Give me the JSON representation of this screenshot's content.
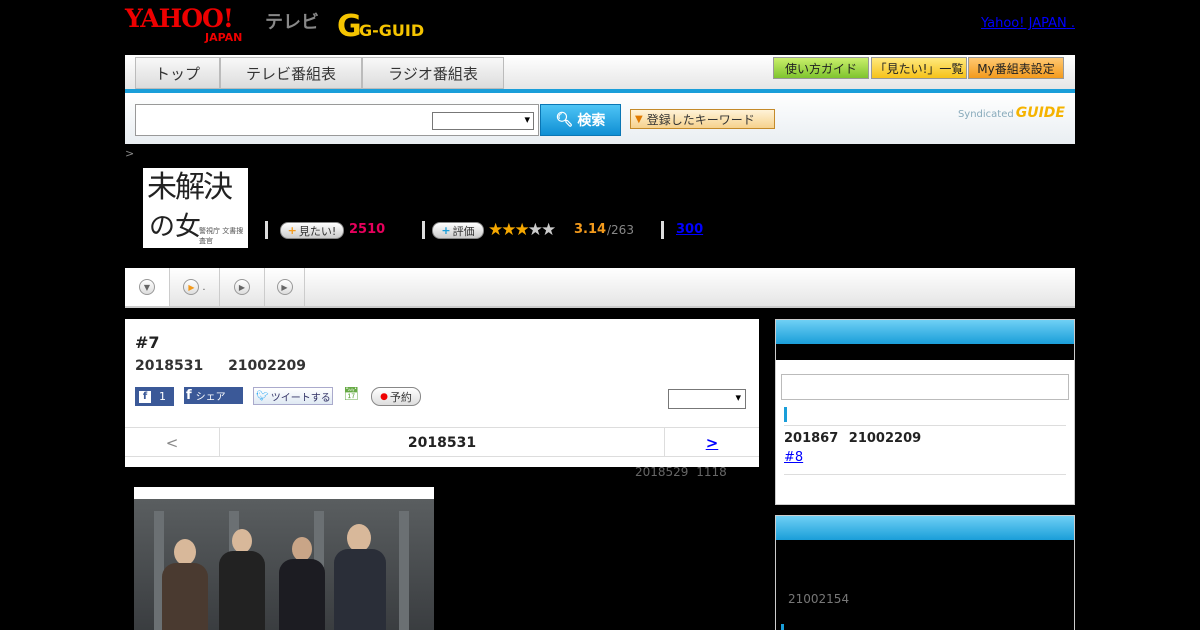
{
  "header": {
    "yahoo_logo": "YAHOO!",
    "japan_logo": "JAPAN",
    "tv_logo": "テレビ",
    "gguide_logo": "G-GUIDE",
    "yahoo_japan_link": "Yahoo! JAPAN"
  },
  "nav": {
    "tabs": [
      {
        "label": "トップ"
      },
      {
        "label": "テレビ番組表"
      },
      {
        "label": "ラジオ番組表"
      }
    ],
    "guide_label": "使い方ガイド",
    "mitai_list_label": "「見たい!」一覧",
    "my_schedule_label": "My番組表設定"
  },
  "search": {
    "input_value": "",
    "select_value": "",
    "button_label": "検索",
    "keyword_label": "登録したキーワード",
    "syndicated_label": "Syndicated",
    "syndicated_logo": "GUIDE"
  },
  "breadcrumb": ">",
  "program": {
    "title_line1": "未解決",
    "title_line2": "の女",
    "title_sub": "警視庁 文書捜査官",
    "mitai_label": "見たい!",
    "mitai_count": "2510",
    "eval_label": "評価",
    "rating": 3.14,
    "stars": "★★★★★",
    "score": "3.14",
    "votes": "/263",
    "comments": "300"
  },
  "episode": {
    "title": "#7",
    "date_time": "2018531 21002209",
    "fb_count": "1",
    "fb_share_label": "シェア",
    "tweet_label": "ツイートする",
    "reserve_label": "予約",
    "select_value": "",
    "nav_prev": "<",
    "nav_current": "2018531",
    "nav_next": ">",
    "updated": "2018529 1118"
  },
  "sidebar": {
    "search_value": "",
    "next_date": "201867 21002209",
    "next_link": "#8",
    "second_date": "21002154"
  },
  "colors": {
    "accent_blue": "#1a9ed9",
    "mitai_pink": "#e6005c",
    "star_orange": "#f6a800",
    "link_blue": "#0000ff"
  }
}
